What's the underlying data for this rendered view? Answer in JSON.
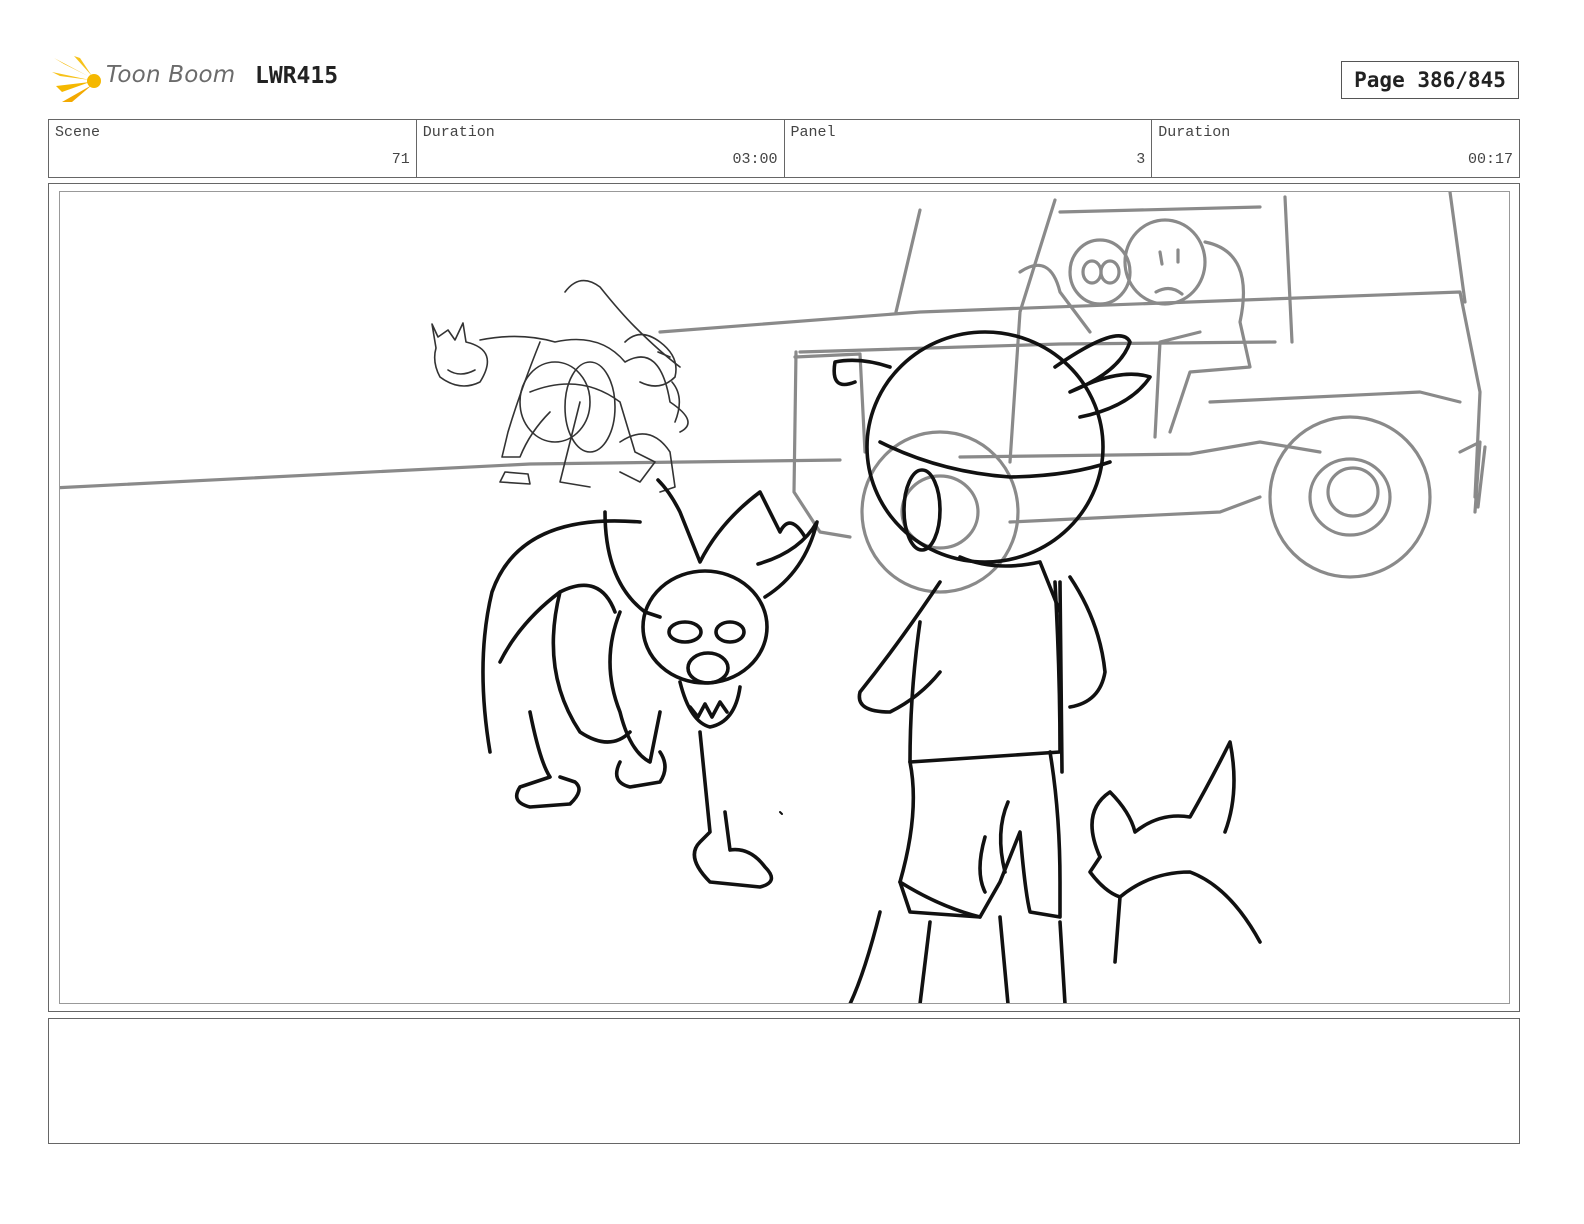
{
  "header": {
    "brand": "Toon Boom",
    "project_code": "LWR415",
    "page_label": "Page 386/845",
    "brand_color": "#f5b800"
  },
  "info": {
    "scene_label": "Scene",
    "scene_value": "71",
    "scene_duration_label": "Duration",
    "scene_duration_value": "03:00",
    "panel_label": "Panel",
    "panel_value": "3",
    "panel_duration_label": "Duration",
    "panel_duration_value": "00:17"
  },
  "panel": {
    "drawing": "storyboard-sketch"
  },
  "notes": {
    "text": ""
  }
}
